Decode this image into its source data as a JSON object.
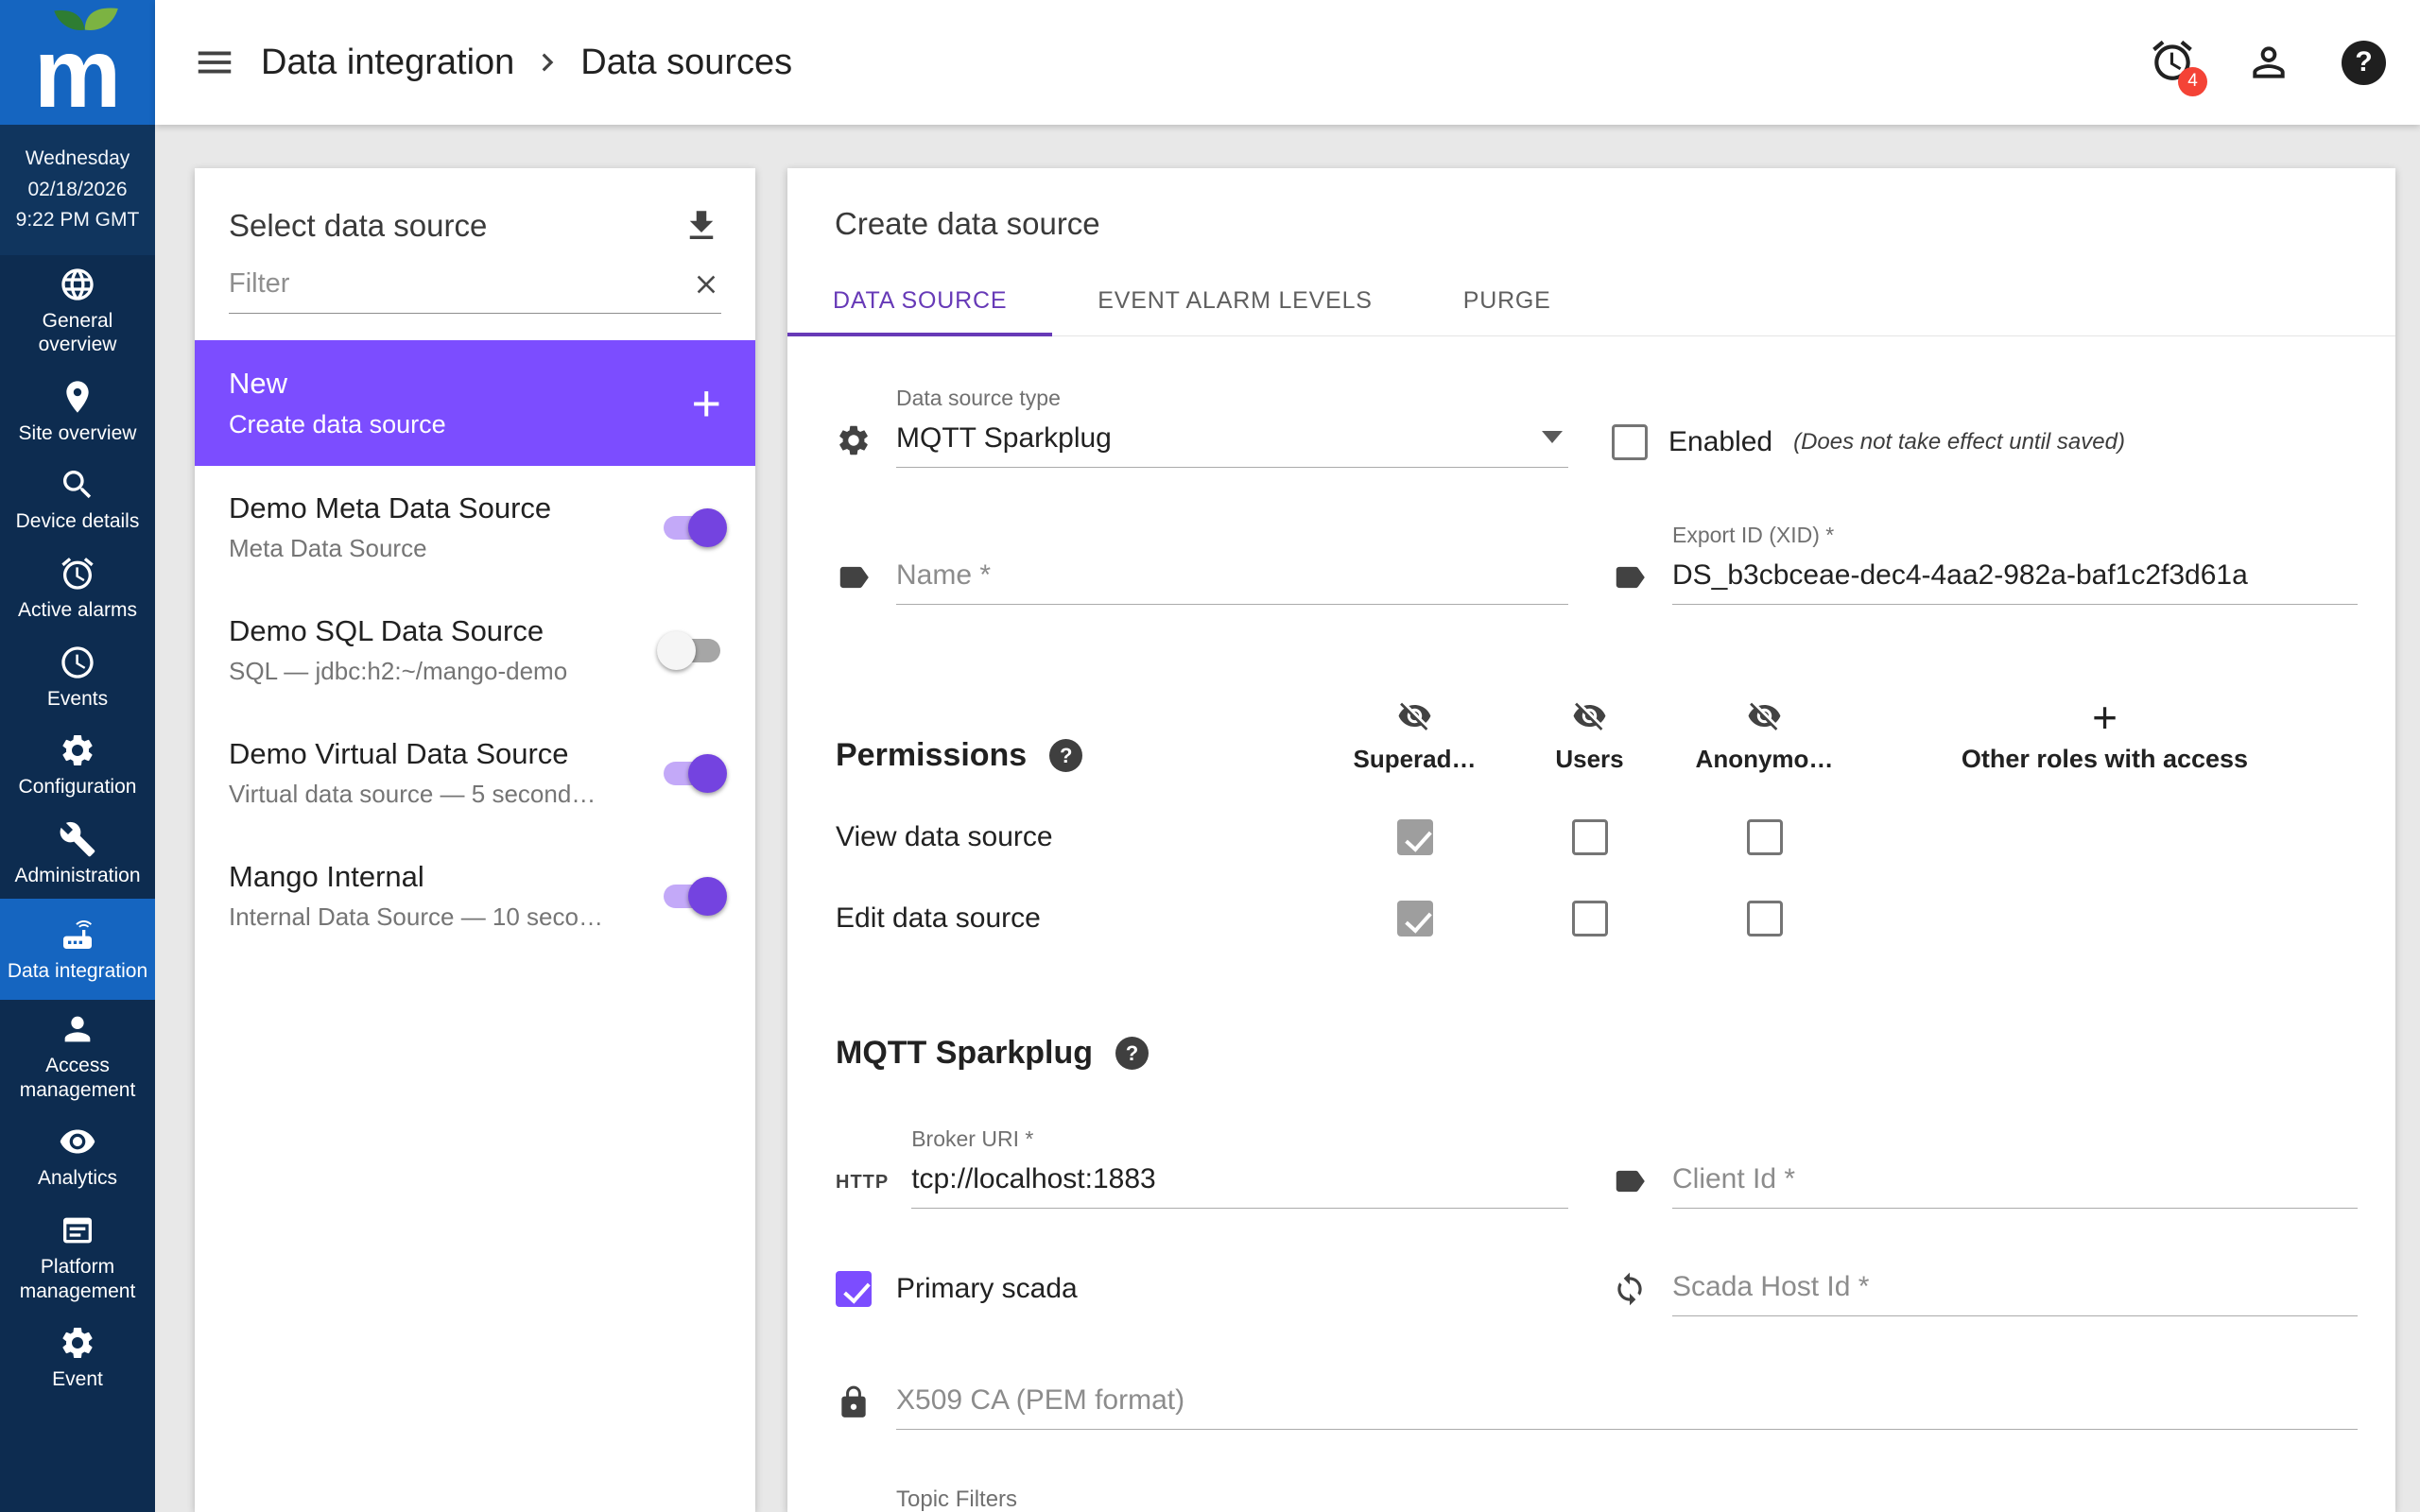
{
  "colors": {
    "accent_purple": "#7C4DFF",
    "tab_active_purple": "#673AB7",
    "sidebar_navy": "#0D2C50",
    "active_item_blue": "#1565C0",
    "badge_red": "#F44336"
  },
  "app": {
    "logo_text": "m",
    "clock": {
      "weekday": "Wednesday",
      "date": "02/18/2026",
      "time": "9:22 PM GMT"
    }
  },
  "sidebar": {
    "items": [
      {
        "label": "General overview",
        "icon": "globe-icon"
      },
      {
        "label": "Site overview",
        "icon": "map-pin-icon"
      },
      {
        "label": "Device details",
        "icon": "search-icon"
      },
      {
        "label": "Active alarms",
        "icon": "alarm-clock-icon"
      },
      {
        "label": "Events",
        "icon": "clock-icon"
      },
      {
        "label": "Configuration",
        "icon": "gear-icon"
      },
      {
        "label": "Administration",
        "icon": "wrench-icon"
      },
      {
        "label": "Data integration",
        "icon": "device-icon",
        "active": true
      },
      {
        "label": "Access management",
        "icon": "person-icon"
      },
      {
        "label": "Analytics",
        "icon": "eye-icon"
      },
      {
        "label": "Platform management",
        "icon": "window-icon"
      },
      {
        "label": "Event",
        "icon": "gear-icon"
      }
    ]
  },
  "header": {
    "breadcrumb": [
      "Data integration",
      "Data sources"
    ],
    "alarm_badge": "4",
    "help_glyph": "?"
  },
  "source_panel": {
    "title": "Select data source",
    "filter_placeholder": "Filter",
    "new_item": {
      "title": "New",
      "subtitle": "Create data source",
      "plus": "+"
    },
    "items": [
      {
        "title": "Demo Meta Data Source",
        "subtitle": "Meta Data Source",
        "enabled": true
      },
      {
        "title": "Demo SQL Data Source",
        "subtitle": "SQL — jdbc:h2:~/mango-demo",
        "enabled": false
      },
      {
        "title": "Demo Virtual Data Source",
        "subtitle": "Virtual data source — 5 second…",
        "enabled": true
      },
      {
        "title": "Mango Internal",
        "subtitle": "Internal Data Source — 10 seco…",
        "enabled": true
      }
    ]
  },
  "editor": {
    "title": "Create data source",
    "tabs": [
      {
        "label": "DATA SOURCE",
        "active": true
      },
      {
        "label": "EVENT ALARM LEVELS"
      },
      {
        "label": "PURGE"
      }
    ],
    "form": {
      "type_label": "Data source type",
      "type_value": "MQTT Sparkplug",
      "enabled_label": "Enabled",
      "enabled_note": "(Does not take effect until saved)",
      "enabled_checked": false,
      "name_placeholder": "Name *",
      "xid_label": "Export ID (XID) *",
      "xid_value": "DS_b3cbceae-dec4-4aa2-982a-baf1c2f3d61a"
    },
    "permissions": {
      "title": "Permissions",
      "help_glyph": "?",
      "columns": [
        "Superad…",
        "Users",
        "Anonymo…"
      ],
      "other_roles": {
        "plus": "+",
        "label": "Other roles with access"
      },
      "rows": [
        {
          "label": "View data source",
          "checks": [
            true,
            false,
            false
          ]
        },
        {
          "label": "Edit data source",
          "checks": [
            true,
            false,
            false
          ]
        }
      ]
    },
    "mqtt": {
      "title": "MQTT Sparkplug",
      "help_glyph": "?",
      "protocol_badge": "HTTP",
      "broker_label": "Broker URI *",
      "broker_value": "tcp://localhost:1883",
      "client_placeholder": "Client Id *",
      "primary_scada_label": "Primary scada",
      "primary_scada_checked": true,
      "scada_host_placeholder": "Scada Host Id *",
      "x509_placeholder": "X509 CA (PEM format)",
      "topic_filters_label": "Topic Filters"
    }
  }
}
